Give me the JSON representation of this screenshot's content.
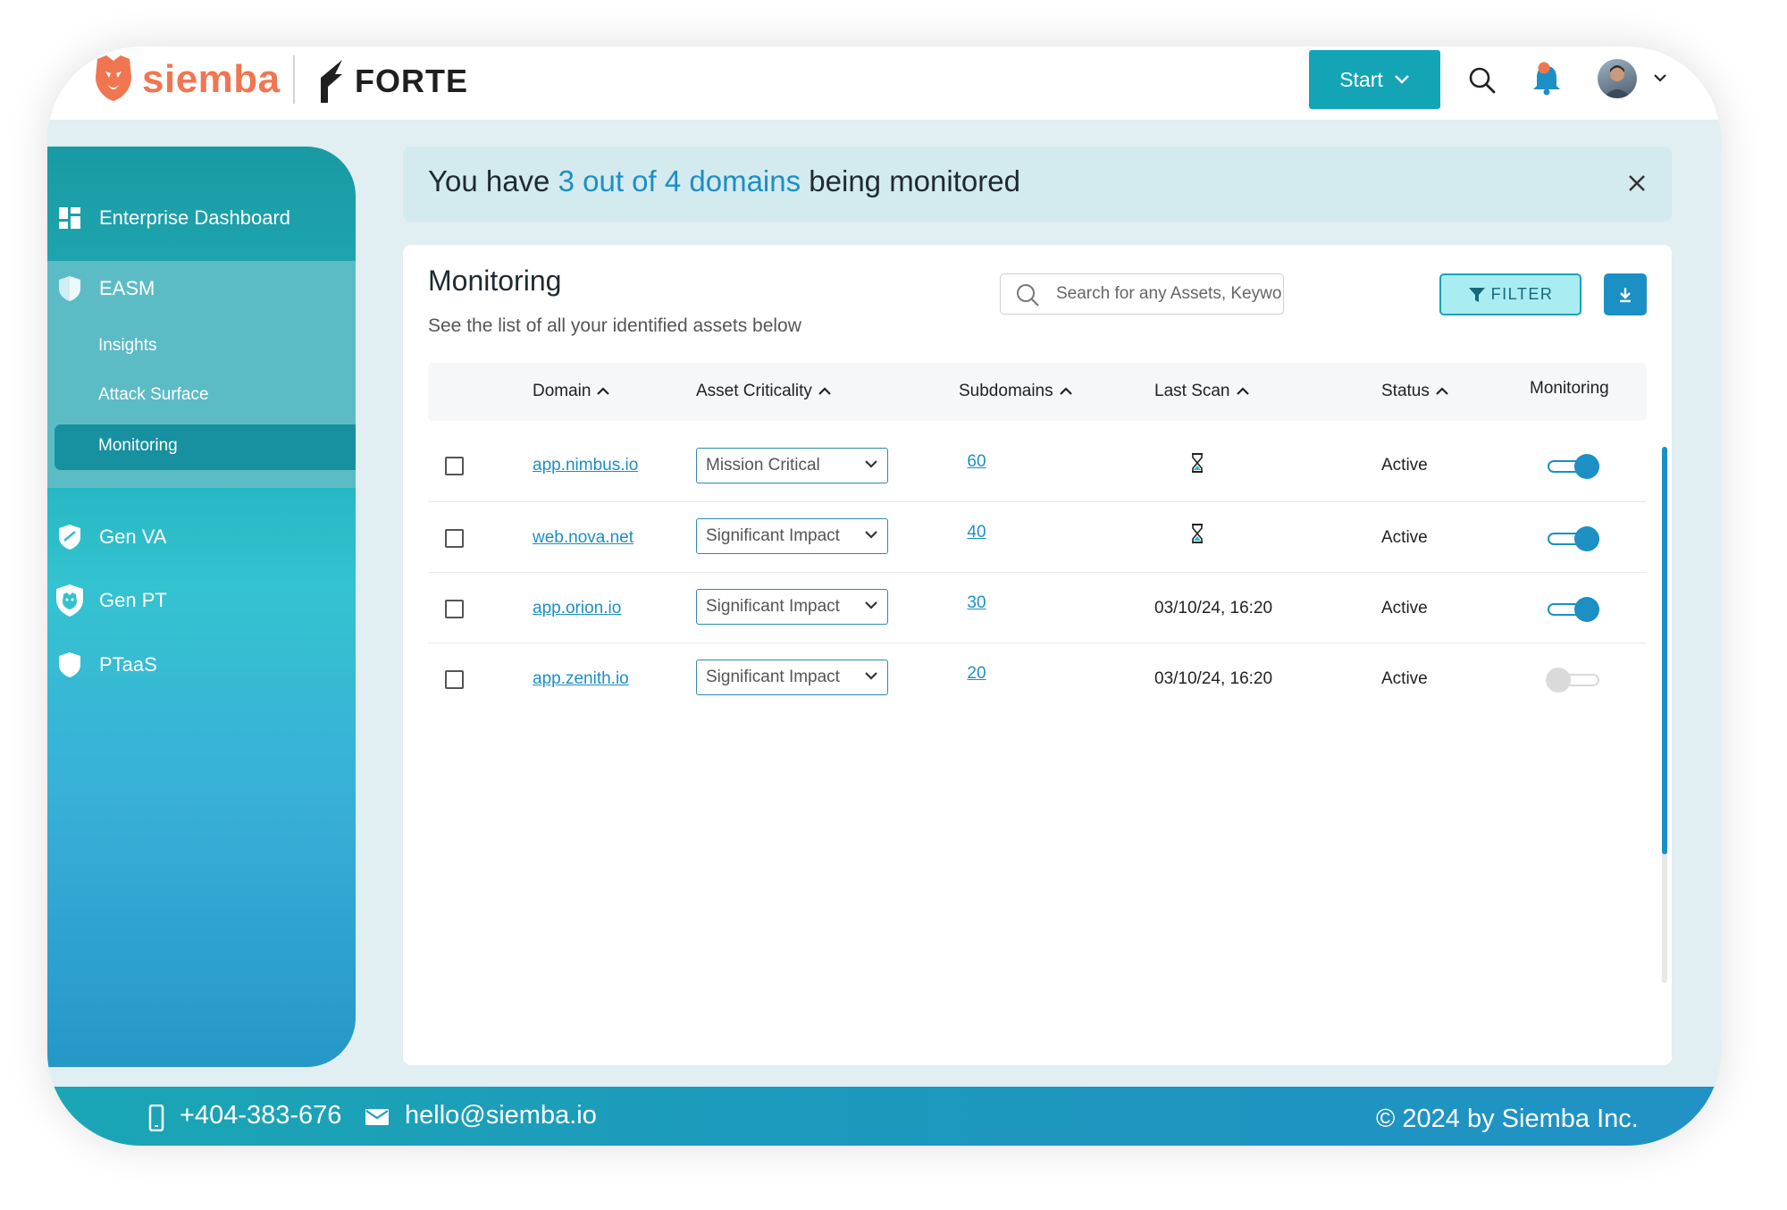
{
  "brand": {
    "name": "siemba",
    "partner": "FORTE"
  },
  "topbar": {
    "start_label": "Start"
  },
  "colors": {
    "accent": "#1c8fc5",
    "teal": "#13a5b5",
    "brand": "#f07651",
    "notification": "#f07651"
  },
  "sidebar": {
    "items": [
      {
        "label": "Enterprise Dashboard",
        "icon": "dashboard-icon"
      },
      {
        "label": "EASM",
        "icon": "shield-icon"
      },
      {
        "label": "Gen VA",
        "icon": "shield-check-icon"
      },
      {
        "label": "Gen PT",
        "icon": "lion-shield-icon"
      },
      {
        "label": "PTaaS",
        "icon": "shield-icon"
      }
    ],
    "submenu": [
      {
        "label": "Insights"
      },
      {
        "label": "Attack Surface"
      },
      {
        "label": "Monitoring",
        "selected": true
      }
    ]
  },
  "banner": {
    "prefix": "You have ",
    "highlight": "3 out of 4 domains",
    "suffix": " being monitored"
  },
  "monitoring": {
    "title": "Monitoring",
    "subtitle": "See the list of all your identified assets below",
    "search_placeholder": "Search for any Assets, Keywords..",
    "filter_label": "FILTER",
    "columns": {
      "domain": "Domain",
      "criticality": "Asset Criticality",
      "subdomains": "Subdomains",
      "last_scan": "Last Scan",
      "status": "Status",
      "monitoring": "Monitoring"
    },
    "rows": [
      {
        "domain": "app.nimbus.io",
        "criticality": "Mission Critical",
        "subdomains": "60",
        "last_scan": "",
        "scanning": true,
        "status": "Active",
        "monitoring": true
      },
      {
        "domain": "web.nova.net",
        "criticality": "Significant Impact",
        "subdomains": "40",
        "last_scan": "",
        "scanning": true,
        "status": "Active",
        "monitoring": true
      },
      {
        "domain": "app.orion.io",
        "criticality": "Significant Impact",
        "subdomains": "30",
        "last_scan": "03/10/24, 16:20",
        "scanning": false,
        "status": "Active",
        "monitoring": true
      },
      {
        "domain": "app.zenith.io",
        "criticality": "Significant Impact",
        "subdomains": "20",
        "last_scan": "03/10/24, 16:20",
        "scanning": false,
        "status": "Active",
        "monitoring": false
      }
    ]
  },
  "footer": {
    "phone": "+404-383-676",
    "email": "hello@siemba.io",
    "copyright": "© 2024 by Siemba Inc."
  }
}
